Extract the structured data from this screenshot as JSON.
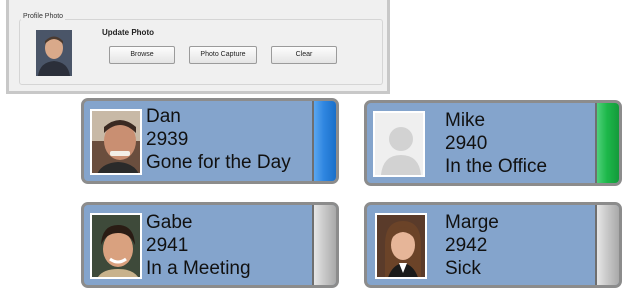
{
  "profile_panel": {
    "legend": "Profile Photo",
    "title": "Update Photo",
    "buttons": {
      "browse": "Browse",
      "photo_capture": "Photo Capture",
      "clear": "Clear"
    }
  },
  "cards": [
    {
      "name": "Dan",
      "ext": "2939",
      "status": "Gone for the Day",
      "status_color": "#2f86e0",
      "photo": "portrait-man"
    },
    {
      "name": "Mike",
      "ext": "2940",
      "status": "In the Office",
      "status_color": "#1db84a",
      "photo": "placeholder-person"
    },
    {
      "name": "Gabe",
      "ext": "2941",
      "status": "In a Meeting",
      "status_color": "#c9c9c9",
      "photo": "portrait-boy"
    },
    {
      "name": "Marge",
      "ext": "2942",
      "status": "Sick",
      "status_color": "#c9c9c9",
      "photo": "portrait-girl"
    }
  ]
}
